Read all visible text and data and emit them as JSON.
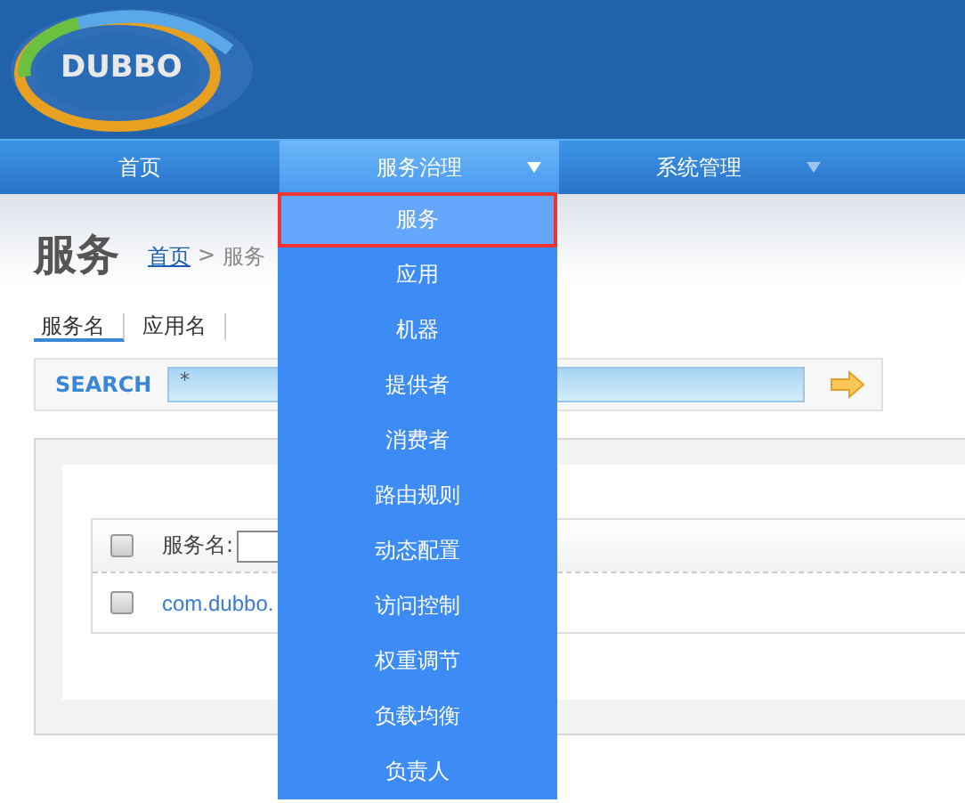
{
  "logo": {
    "text": "DUBBO"
  },
  "nav": [
    {
      "label": "首页",
      "selected": false,
      "caret": false
    },
    {
      "label": "服务治理",
      "selected": true,
      "caret": true
    },
    {
      "label": "系统管理",
      "selected": false,
      "caret": true
    }
  ],
  "menu": [
    {
      "label": "服务",
      "selected": true
    },
    {
      "label": "应用",
      "selected": false
    },
    {
      "label": "机器",
      "selected": false
    },
    {
      "label": "提供者",
      "selected": false
    },
    {
      "label": "消费者",
      "selected": false
    },
    {
      "label": "路由规则",
      "selected": false
    },
    {
      "label": "动态配置",
      "selected": false
    },
    {
      "label": "访问控制",
      "selected": false
    },
    {
      "label": "权重调节",
      "selected": false
    },
    {
      "label": "负载均衡",
      "selected": false
    },
    {
      "label": "负责人",
      "selected": false
    }
  ],
  "page_title": "服务",
  "breadcrumb": {
    "link": "首页",
    "separator": ">",
    "current": "服务"
  },
  "tabs": [
    {
      "label": "服务名",
      "selected": true
    },
    {
      "label": "应用名",
      "selected": false
    }
  ],
  "search": {
    "label": "SEARCH",
    "value": "*"
  },
  "table": {
    "header": {
      "checked": false,
      "label": "服务名:"
    },
    "rows": [
      {
        "checked": false,
        "service": "com.dubbo."
      }
    ]
  }
}
